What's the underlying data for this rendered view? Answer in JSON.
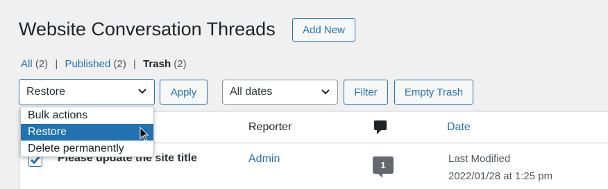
{
  "header": {
    "title": "Website Conversation Threads",
    "add_new": "Add New"
  },
  "views": [
    {
      "label": "All",
      "count": "(2)"
    },
    {
      "label": "Published",
      "count": "(2)"
    },
    {
      "label": "Trash",
      "count": "(2)"
    }
  ],
  "bulk_actions": {
    "selected": "Restore",
    "options": [
      "Bulk actions",
      "Restore",
      "Delete permanently"
    ],
    "apply": "Apply"
  },
  "date_filter": {
    "selected": "All dates",
    "filter": "Filter"
  },
  "empty_trash": "Empty Trash",
  "table": {
    "columns": {
      "reporter": "Reporter",
      "date": "Date"
    },
    "rows": [
      {
        "title": "Please update the site title",
        "reporter": "Admin",
        "comments": "1",
        "date_status": "Last Modified",
        "date_value": "2022/01/28 at 1:25 pm"
      }
    ]
  },
  "colors": {
    "accent": "#2271b1",
    "text": "#1d2327",
    "background": "#f0f0f1"
  },
  "icons": [
    "chevron-down-icon",
    "comment-icon",
    "checkbox-checked-icon",
    "mouse-pointer-icon"
  ]
}
